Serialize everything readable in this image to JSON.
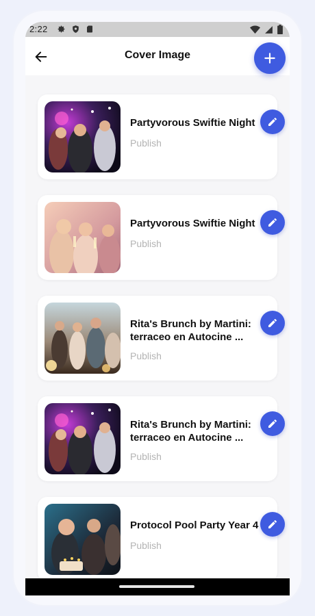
{
  "status_bar": {
    "time": "2:22",
    "left_icons": [
      "gear-icon",
      "shield-icon",
      "sd-card-icon"
    ],
    "right_icons": [
      "wifi-icon",
      "signal-icon",
      "battery-icon"
    ]
  },
  "app_bar": {
    "back_icon": "arrow-left-icon",
    "title": "Cover Image",
    "add_icon": "plus-icon"
  },
  "colors": {
    "accent": "#3f5be0",
    "muted": "#b3b3b3"
  },
  "cards": [
    {
      "title": "Partyvorous Swiftie Night",
      "status": "Publish",
      "image": "party-crowd-photo"
    },
    {
      "title": "Partyvorous Swiftie Night",
      "status": "Publish",
      "image": "friends-toasting-photo"
    },
    {
      "title": "Rita's Brunch by Martini: terraceo en Autocine ...",
      "status": "Publish",
      "image": "rooftop-party-photo"
    },
    {
      "title": "Rita's Brunch by Martini: terraceo en Autocine ...",
      "status": "Publish",
      "image": "party-crowd-photo"
    },
    {
      "title": "Protocol Pool Party Year 4",
      "status": "Publish",
      "image": "birthday-cake-photo"
    }
  ]
}
